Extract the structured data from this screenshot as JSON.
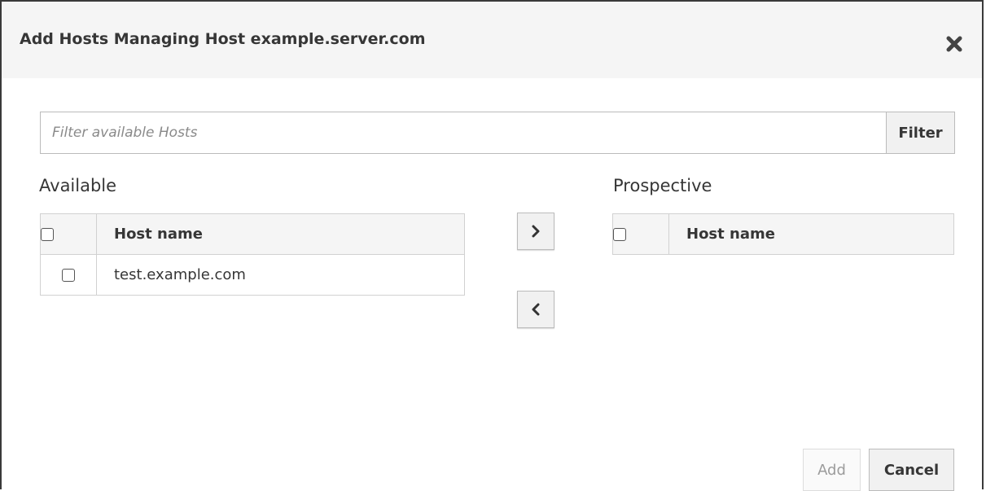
{
  "dialog": {
    "title": "Add Hosts Managing Host example.server.com",
    "close_icon": "close-icon"
  },
  "filter": {
    "placeholder": "Filter available Hosts",
    "value": "",
    "button_label": "Filter"
  },
  "available": {
    "label": "Available",
    "header": "Host name",
    "rows": [
      {
        "name": "test.example.com",
        "checked": false
      }
    ]
  },
  "prospective": {
    "label": "Prospective",
    "header": "Host name",
    "rows": []
  },
  "move_buttons": {
    "add_icon": "chevron-right-icon",
    "remove_icon": "chevron-left-icon"
  },
  "footer": {
    "add_label": "Add",
    "add_disabled": true,
    "cancel_label": "Cancel"
  }
}
